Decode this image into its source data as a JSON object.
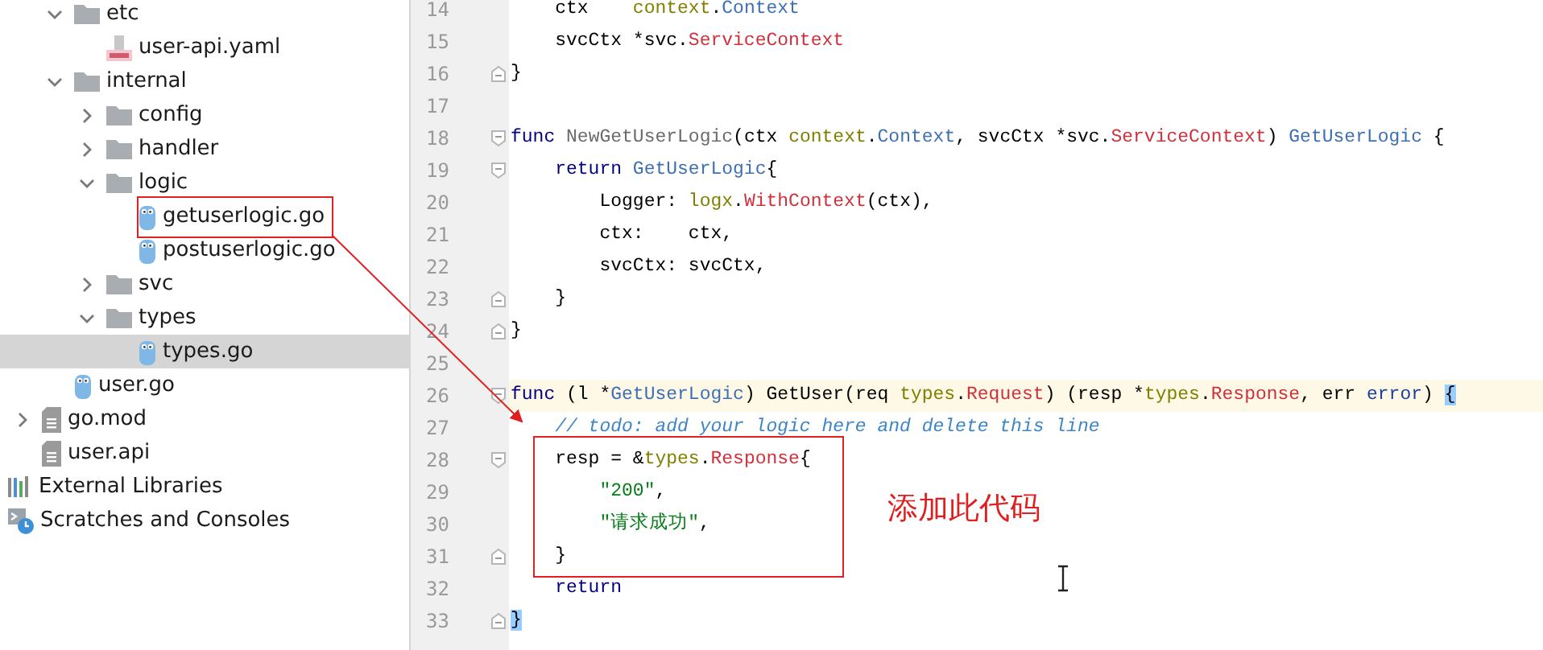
{
  "project_tree": {
    "items": [
      {
        "kind": "offscreen",
        "children": [
          {
            "kind": "offscreen",
            "children": [
              {
                "label": "etc",
                "kind": "folder",
                "expanded": true,
                "selected": false,
                "children": [
                  {
                    "label": "user-api.yaml",
                    "kind": "yaml",
                    "selected": false
                  }
                ]
              },
              {
                "label": "internal",
                "kind": "folder",
                "expanded": true,
                "selected": false,
                "children": [
                  {
                    "label": "config",
                    "kind": "folder",
                    "expanded": false,
                    "selected": false
                  },
                  {
                    "label": "handler",
                    "kind": "folder",
                    "expanded": false,
                    "selected": false
                  },
                  {
                    "label": "logic",
                    "kind": "folder",
                    "expanded": true,
                    "selected": false,
                    "children": [
                      {
                        "label": "getuserlogic.go",
                        "kind": "go",
                        "selected": false
                      },
                      {
                        "label": "postuserlogic.go",
                        "kind": "go",
                        "selected": false
                      }
                    ]
                  },
                  {
                    "label": "svc",
                    "kind": "folder",
                    "expanded": false,
                    "selected": false
                  },
                  {
                    "label": "types",
                    "kind": "folder",
                    "expanded": true,
                    "selected": false,
                    "children": [
                      {
                        "label": "types.go",
                        "kind": "go",
                        "selected": true
                      }
                    ]
                  }
                ]
              },
              {
                "label": "user.go",
                "kind": "go",
                "selected": false
              }
            ]
          },
          {
            "label": "go.mod",
            "kind": "text",
            "expanded": false,
            "selected": false
          },
          {
            "label": "user.api",
            "kind": "text",
            "selected": false
          }
        ]
      },
      {
        "label": "External Libraries",
        "kind": "libraries",
        "selected": false
      },
      {
        "label": "Scratches and Consoles",
        "kind": "scratches",
        "selected": false
      }
    ]
  },
  "editor": {
    "lines": [
      {
        "number": "14",
        "kind": "plain",
        "current": false,
        "tokens": [
          {
            "text": "    ctx    ",
            "kind": "plain"
          },
          {
            "text": "context",
            "kind": "package"
          },
          {
            "text": ".",
            "kind": "plain"
          },
          {
            "text": "Context",
            "kind": "interface"
          }
        ]
      },
      {
        "number": "15",
        "kind": "plain",
        "current": false,
        "tokens": [
          {
            "text": "    svcCtx *svc.",
            "kind": "plain"
          },
          {
            "text": "ServiceContext",
            "kind": "struct"
          }
        ]
      },
      {
        "number": "16",
        "kind": "fold-end",
        "current": false,
        "tokens": [
          {
            "text": "}",
            "kind": "plain"
          }
        ]
      },
      {
        "number": "17",
        "kind": "plain",
        "current": false
      },
      {
        "number": "18",
        "kind": "fold-start",
        "current": false,
        "tokens": [
          {
            "text": "func ",
            "kind": "keyword"
          },
          {
            "text": "NewGetUserLogic",
            "kind": "unused"
          },
          {
            "text": "(ctx ",
            "kind": "plain"
          },
          {
            "text": "context",
            "kind": "package"
          },
          {
            "text": ".",
            "kind": "plain"
          },
          {
            "text": "Context",
            "kind": "interface"
          },
          {
            "text": ", svcCtx *svc.",
            "kind": "plain"
          },
          {
            "text": "ServiceContext",
            "kind": "struct"
          },
          {
            "text": ") ",
            "kind": "plain"
          },
          {
            "text": "GetUserLogic",
            "kind": "interface"
          },
          {
            "text": " {",
            "kind": "plain"
          }
        ]
      },
      {
        "number": "19",
        "kind": "fold-start",
        "current": false,
        "tokens": [
          {
            "text": "    return ",
            "kind": "keyword"
          },
          {
            "text": "GetUserLogic",
            "kind": "interface"
          },
          {
            "text": "{",
            "kind": "plain"
          }
        ]
      },
      {
        "number": "20",
        "kind": "plain",
        "current": false,
        "tokens": [
          {
            "text": "        Logger: ",
            "kind": "plain"
          },
          {
            "text": "logx",
            "kind": "package"
          },
          {
            "text": ".",
            "kind": "plain"
          },
          {
            "text": "WithContext",
            "kind": "struct"
          },
          {
            "text": "(ctx),",
            "kind": "plain"
          }
        ]
      },
      {
        "number": "21",
        "kind": "plain",
        "current": false,
        "tokens": [
          {
            "text": "        ctx:    ctx,",
            "kind": "plain"
          }
        ]
      },
      {
        "number": "22",
        "kind": "plain",
        "current": false,
        "tokens": [
          {
            "text": "        svcCtx: svcCtx,",
            "kind": "plain"
          }
        ]
      },
      {
        "number": "23",
        "kind": "fold-end",
        "current": false,
        "tokens": [
          {
            "text": "    }",
            "kind": "plain"
          }
        ]
      },
      {
        "number": "24",
        "kind": "fold-end",
        "current": false,
        "tokens": [
          {
            "text": "}",
            "kind": "plain"
          }
        ]
      },
      {
        "number": "25",
        "kind": "plain",
        "current": false
      },
      {
        "number": "26",
        "kind": "fold-start",
        "current": true,
        "tokens": [
          {
            "text": "func",
            "kind": "keyword"
          },
          {
            "text": " (l *",
            "kind": "plain"
          },
          {
            "text": "GetUserLogic",
            "kind": "interface"
          },
          {
            "text": ") GetUser(req ",
            "kind": "plain"
          },
          {
            "text": "types",
            "kind": "package"
          },
          {
            "text": ".",
            "kind": "plain"
          },
          {
            "text": "Request",
            "kind": "struct"
          },
          {
            "text": ") (resp *",
            "kind": "plain"
          },
          {
            "text": "types",
            "kind": "package"
          },
          {
            "text": ".",
            "kind": "plain"
          },
          {
            "text": "Response",
            "kind": "struct"
          },
          {
            "text": ", err ",
            "kind": "plain"
          },
          {
            "text": "error",
            "kind": "builtin"
          },
          {
            "text": ") ",
            "kind": "plain"
          },
          {
            "text": "{",
            "kind": "brace-match"
          }
        ]
      },
      {
        "number": "27",
        "kind": "plain",
        "current": false,
        "tokens": [
          {
            "text": "    // todo: add your logic here and delete this line",
            "kind": "comment"
          }
        ]
      },
      {
        "number": "28",
        "kind": "fold-start",
        "current": false,
        "tokens": [
          {
            "text": "    resp = &",
            "kind": "plain"
          },
          {
            "text": "types",
            "kind": "package"
          },
          {
            "text": ".",
            "kind": "plain"
          },
          {
            "text": "Response",
            "kind": "struct"
          },
          {
            "text": "{",
            "kind": "plain"
          }
        ]
      },
      {
        "number": "29",
        "kind": "plain",
        "current": false,
        "tokens": [
          {
            "text": "        \"200\"",
            "kind": "string"
          },
          {
            "text": ",",
            "kind": "plain"
          }
        ]
      },
      {
        "number": "30",
        "kind": "plain",
        "current": false,
        "tokens": [
          {
            "text": "        \"请求成功\"",
            "kind": "string"
          },
          {
            "text": ",",
            "kind": "plain"
          }
        ]
      },
      {
        "number": "31",
        "kind": "fold-end",
        "current": false,
        "tokens": [
          {
            "text": "    }",
            "kind": "plain"
          }
        ]
      },
      {
        "number": "32",
        "kind": "plain",
        "current": false,
        "tokens": [
          {
            "text": "    return",
            "kind": "keyword"
          }
        ]
      },
      {
        "number": "33",
        "kind": "fold-end",
        "current": false,
        "tokens": [
          {
            "text": "}",
            "kind": "brace-match"
          }
        ]
      }
    ]
  },
  "annotation": {
    "note": "添加此代码"
  }
}
